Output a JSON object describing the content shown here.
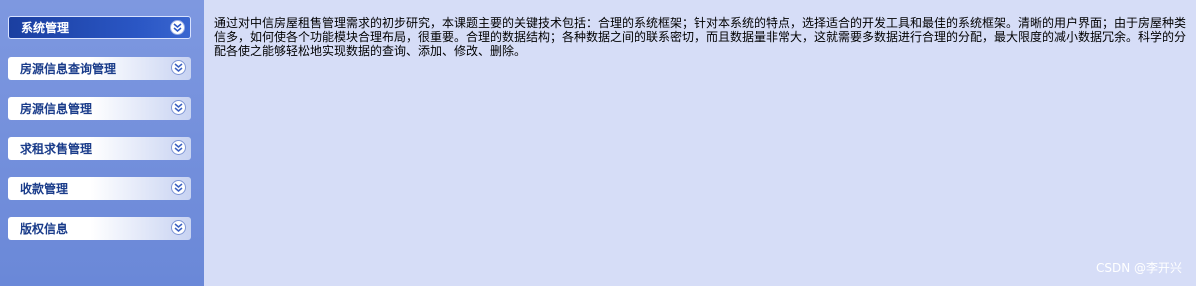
{
  "sidebar": {
    "items": [
      {
        "label": "系统管理",
        "icon": "double-chevron-down-icon"
      },
      {
        "label": "房源信息查询管理",
        "icon": "double-chevron-down-icon"
      },
      {
        "label": "房源信息管理",
        "icon": "double-chevron-down-icon"
      },
      {
        "label": "求租求售管理",
        "icon": "double-chevron-down-icon"
      },
      {
        "label": "收款管理",
        "icon": "double-chevron-down-icon"
      },
      {
        "label": "版权信息",
        "icon": "double-chevron-down-icon"
      }
    ]
  },
  "main": {
    "text": "通过对中信房屋租售管理需求的初步研究，本课题主要的关键技术包括：合理的系统框架；针对本系统的特点，选择适合的开发工具和最佳的系统框架。清晰的用户界面；由于房屋种类信多，如何使各个功能模块合理布局，很重要。合理的数据结构；各种数据之间的联系密切，而且数据量非常大，这就需要多数据进行合理的分配，最大限度的减小数据冗余。科学的分配各使之能够轻松地实现数据的查询、添加、修改、删除。"
  },
  "watermark": "CSDN @李开兴",
  "colors": {
    "sidebar_bg": "#7e98e0",
    "content_bg": "#d6ddf7",
    "active_item_bg": "#1b3fa0",
    "inactive_item_text": "#1a3c8a"
  }
}
